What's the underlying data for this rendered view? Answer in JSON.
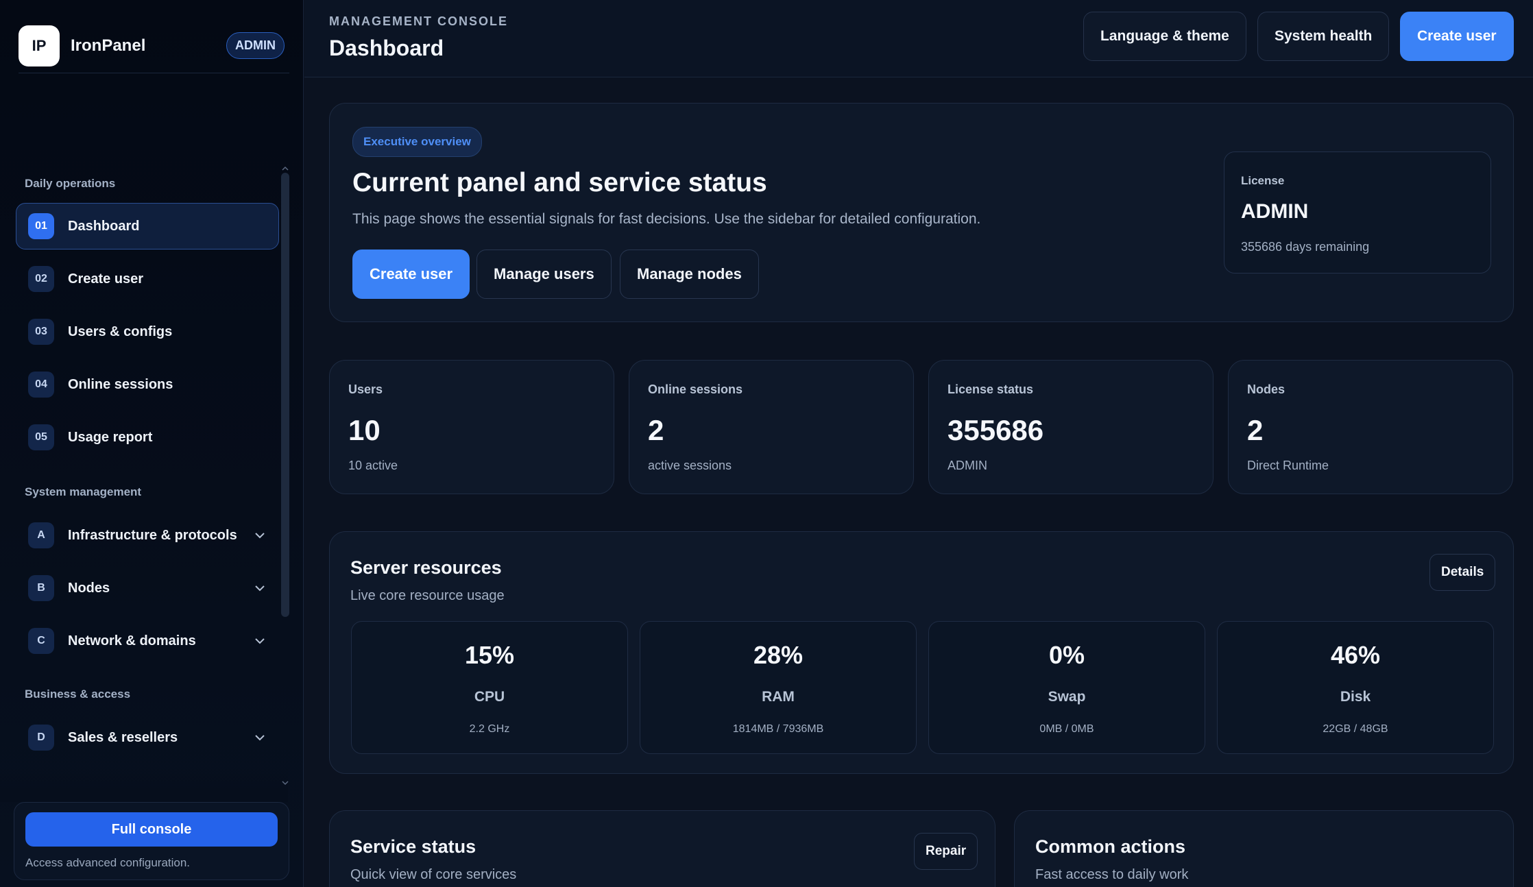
{
  "sidebar": {
    "brand": {
      "logo_text": "IP",
      "name": "IronPanel",
      "badge": "ADMIN"
    },
    "sections": [
      {
        "title": "Daily operations"
      },
      {
        "title": "System management"
      },
      {
        "title": "Business & access"
      }
    ],
    "items": [
      {
        "num": "01",
        "label": "Dashboard",
        "active": true
      },
      {
        "num": "02",
        "label": "Create user"
      },
      {
        "num": "03",
        "label": "Users & configs"
      },
      {
        "num": "04",
        "label": "Online sessions"
      },
      {
        "num": "05",
        "label": "Usage report"
      },
      {
        "num": "A",
        "label": "Infrastructure & protocols",
        "expandable": true
      },
      {
        "num": "B",
        "label": "Nodes",
        "expandable": true
      },
      {
        "num": "C",
        "label": "Network & domains",
        "expandable": true
      },
      {
        "num": "D",
        "label": "Sales & resellers",
        "expandable": true
      }
    ],
    "footer": {
      "button_label": "Full console",
      "text": "Access advanced configuration."
    }
  },
  "topbar": {
    "kicker": "MANAGEMENT CONSOLE",
    "title": "Dashboard",
    "buttons": {
      "language": "Language & theme",
      "health": "System health",
      "create": "Create user"
    }
  },
  "hero": {
    "badge": "Executive overview",
    "title": "Current panel and service status",
    "description": "This page shows the essential signals for fast decisions. Use the sidebar for detailed configuration.",
    "buttons": {
      "create": "Create user",
      "manage_users": "Manage users",
      "manage_nodes": "Manage nodes"
    },
    "license": {
      "label": "License",
      "value": "ADMIN",
      "sub": "355686 days remaining"
    }
  },
  "stats": [
    {
      "label": "Users",
      "value": "10",
      "sub": "10 active"
    },
    {
      "label": "Online sessions",
      "value": "2",
      "sub": "active sessions"
    },
    {
      "label": "License status",
      "value": "355686",
      "sub": "ADMIN"
    },
    {
      "label": "Nodes",
      "value": "2",
      "sub": "Direct Runtime"
    }
  ],
  "resources": {
    "title": "Server resources",
    "subtitle": "Live core resource usage",
    "details_label": "Details",
    "items": [
      {
        "value": "15%",
        "label": "CPU",
        "sub": "2.2 GHz"
      },
      {
        "value": "28%",
        "label": "RAM",
        "sub": "1814MB / 7936MB"
      },
      {
        "value": "0%",
        "label": "Swap",
        "sub": "0MB / 0MB"
      },
      {
        "value": "46%",
        "label": "Disk",
        "sub": "22GB / 48GB"
      }
    ]
  },
  "service": {
    "title": "Service status",
    "subtitle": "Quick view of core services",
    "repair_label": "Repair"
  },
  "actions": {
    "title": "Common actions",
    "subtitle": "Fast access to daily work"
  },
  "colors": {
    "accent": "#3b82f6",
    "background": "#0b1220",
    "card": "#0e1829"
  },
  "icons": {
    "chevron": "chevron-down-icon"
  }
}
